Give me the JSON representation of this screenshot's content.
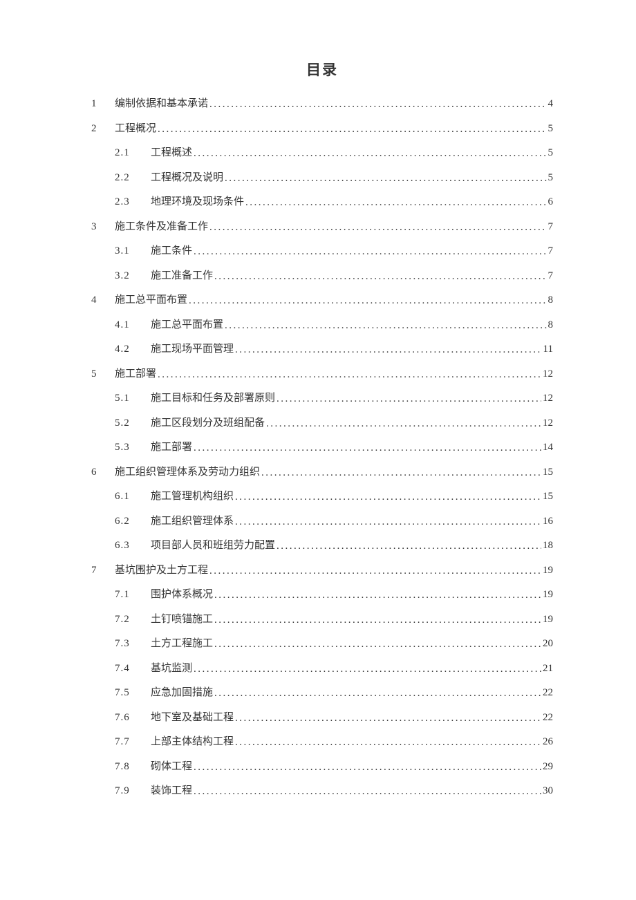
{
  "title": "目录",
  "entries": [
    {
      "level": 1,
      "num": "1",
      "text": "编制依据和基本承诺",
      "page": "4"
    },
    {
      "level": 1,
      "num": "2",
      "text": "工程概况",
      "page": "5"
    },
    {
      "level": 2,
      "num": "2.1",
      "text": "工程概述",
      "page": "5"
    },
    {
      "level": 2,
      "num": "2.2",
      "text": "工程概况及说明",
      "page": "5"
    },
    {
      "level": 2,
      "num": "2.3",
      "text": "地理环境及现场条件",
      "page": "6"
    },
    {
      "level": 1,
      "num": "3",
      "text": "施工条件及准备工作",
      "page": "7"
    },
    {
      "level": 2,
      "num": "3.1",
      "text": "施工条件",
      "page": "7"
    },
    {
      "level": 2,
      "num": "3.2",
      "text": "施工准备工作",
      "page": "7"
    },
    {
      "level": 1,
      "num": "4",
      "text": "施工总平面布置",
      "page": "8"
    },
    {
      "level": 2,
      "num": "4.1",
      "text": "施工总平面布置",
      "page": "8"
    },
    {
      "level": 2,
      "num": "4.2",
      "text": "施工现场平面管理",
      "page": "11"
    },
    {
      "level": 1,
      "num": "5",
      "text": "施工部署",
      "page": "12"
    },
    {
      "level": 2,
      "num": "5.1",
      "text": "施工目标和任务及部署原则",
      "page": "12"
    },
    {
      "level": 2,
      "num": "5.2",
      "text": "施工区段划分及班组配备",
      "page": "12"
    },
    {
      "level": 2,
      "num": "5.3",
      "text": "施工部署",
      "page": "14"
    },
    {
      "level": 1,
      "num": "6",
      "text": "施工组织管理体系及劳动力组织",
      "page": "15"
    },
    {
      "level": 2,
      "num": "6.1",
      "text": "施工管理机构组织",
      "page": "15"
    },
    {
      "level": 2,
      "num": "6.2",
      "text": "施工组织管理体系",
      "page": "16"
    },
    {
      "level": 2,
      "num": "6.3",
      "text": "项目部人员和班组劳力配置",
      "page": "18"
    },
    {
      "level": 1,
      "num": "7",
      "text": "基坑围护及土方工程",
      "page": "19"
    },
    {
      "level": 2,
      "num": "7.1",
      "text": "围护体系概况",
      "page": "19"
    },
    {
      "level": 2,
      "num": "7.2",
      "text": "土钉喷锚施工",
      "page": "19"
    },
    {
      "level": 2,
      "num": "7.3",
      "text": "土方工程施工",
      "page": "20"
    },
    {
      "level": 2,
      "num": "7.4",
      "text": "基坑监测",
      "page": "21"
    },
    {
      "level": 2,
      "num": "7.5",
      "text": "应急加固措施",
      "page": "22"
    },
    {
      "level": 2,
      "num": "7.6",
      "text": "地下室及基础工程",
      "page": "22"
    },
    {
      "level": 2,
      "num": "7.7",
      "text": "上部主体结构工程",
      "page": "26"
    },
    {
      "level": 2,
      "num": "7.8",
      "text": "砌体工程",
      "page": "29"
    },
    {
      "level": 2,
      "num": "7.9",
      "text": "装饰工程",
      "page": "30"
    }
  ]
}
